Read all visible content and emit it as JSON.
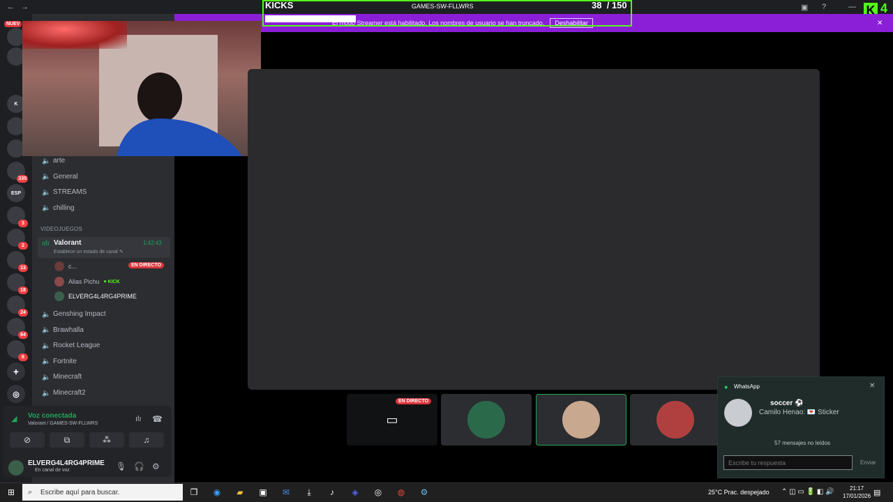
{
  "kicks_overlay": {
    "title": "KICKS",
    "server": "GAMES-SW-FLLWRS",
    "count": "38",
    "goal": "/ 150",
    "progress": 0.25,
    "accent": "#53fc18"
  },
  "banner": {
    "text": "El modo Streamer está habilitado. Los nombres de usuario se han truncado.",
    "button": "Deshabilitar",
    "color": "#8b1fd8"
  },
  "rail": {
    "top_label": "NUEV",
    "servers": [
      {
        "label": "",
        "badge": ""
      },
      {
        "label": "",
        "badge": ""
      },
      {
        "label": "K",
        "badge": ""
      },
      {
        "label": "",
        "badge": ""
      },
      {
        "label": "",
        "badge": ""
      },
      {
        "label": "",
        "badge": "335"
      },
      {
        "label": "ESP",
        "badge": ""
      },
      {
        "label": "",
        "badge": "3"
      },
      {
        "label": "",
        "badge": "2"
      },
      {
        "label": "",
        "badge": "13"
      },
      {
        "label": "",
        "badge": "18"
      },
      {
        "label": "",
        "badge": "24"
      },
      {
        "label": "",
        "badge": "64"
      },
      {
        "label": "",
        "badge": "6"
      }
    ]
  },
  "channels_top": [
    "arte",
    "General",
    "STREAMS",
    "chilling"
  ],
  "category": "VIDEOJUEGOS",
  "active_channel": {
    "name": "Valorant",
    "time": "1:42:43",
    "status": "Establece un estado de canal"
  },
  "members": [
    {
      "name": "c...",
      "live": "EN DIRECTO",
      "kick": ""
    },
    {
      "name": "Alias Pichu",
      "live": "",
      "kick": "KICK"
    },
    {
      "name": "ELVERG4L4RG4PRIME",
      "live": "",
      "kick": ""
    }
  ],
  "channels_bottom": [
    "Genshing Impact",
    "Brawhalla",
    "Rocket League",
    "Fortnite",
    "Minecraft",
    "Minecraft2"
  ],
  "voice": {
    "title": "Voz conectada",
    "sub": "Valorant / GAMES-SW-FLLWRS"
  },
  "user": {
    "name": "ELVERG4L4RG4PRIME",
    "status": "En canal de voz"
  },
  "tile_live": "EN DIRECTO",
  "whatsapp": {
    "app": "WhatsApp",
    "title": "soccer ⚽",
    "msg": "Camilo Henao: 💌 Sticker",
    "unread": "57 mensajes no leídos",
    "placeholder": "Escribe tu respuesta",
    "send": "Enviar"
  },
  "taskbar": {
    "search": "Escribe aquí para buscar.",
    "weather": "25°C  Prac. despejado",
    "time": "21:17",
    "date": "17/01/2026"
  }
}
